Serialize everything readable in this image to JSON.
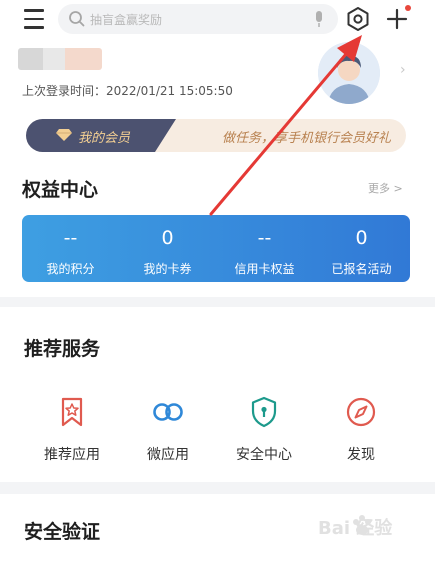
{
  "search": {
    "placeholder": "抽盲盒赢奖励"
  },
  "profile": {
    "last_login": "上次登录时间：2022/01/21 15:05:50"
  },
  "member": {
    "badge_label": "我的会员",
    "promo_text": "做任务，享手机银行会员好礼"
  },
  "rights": {
    "title": "权益中心",
    "more": "更多 >",
    "stats": [
      {
        "value": "--",
        "label": "我的积分"
      },
      {
        "value": "0",
        "label": "我的卡券"
      },
      {
        "value": "--",
        "label": "信用卡权益"
      },
      {
        "value": "0",
        "label": "已报名活动"
      }
    ]
  },
  "services": {
    "title": "推荐服务",
    "items": [
      {
        "label": "推荐应用",
        "icon": "bookmark-star-icon"
      },
      {
        "label": "微应用",
        "icon": "link-rings-icon"
      },
      {
        "label": "安全中心",
        "icon": "shield-icon"
      },
      {
        "label": "发现",
        "icon": "compass-icon"
      }
    ]
  },
  "security": {
    "title": "安全验证"
  },
  "watermark": {
    "text": "Bai 经验"
  },
  "colors": {
    "accent_blue": "#3a8fe0",
    "member_dark": "#4c5270",
    "annotation_red": "#e53935",
    "icon_red": "#e05a4f",
    "icon_blue": "#2f88d8",
    "icon_teal": "#1d9a8c"
  }
}
